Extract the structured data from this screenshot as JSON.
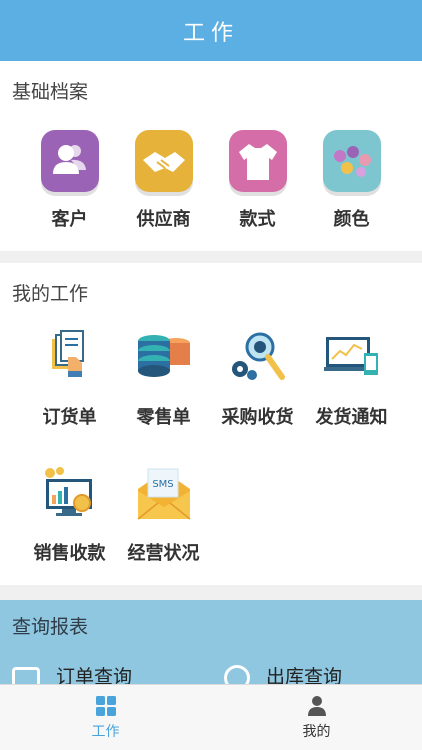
{
  "header": {
    "title": "工作"
  },
  "basic": {
    "title": "基础档案",
    "items": [
      {
        "label": "客户",
        "icon": "customers-icon"
      },
      {
        "label": "供应商",
        "icon": "handshake-icon"
      },
      {
        "label": "款式",
        "icon": "shirt-icon"
      },
      {
        "label": "颜色",
        "icon": "palette-icon"
      }
    ]
  },
  "work": {
    "title": "我的工作",
    "items": [
      {
        "label": "订货单",
        "icon": "order-doc-icon"
      },
      {
        "label": "零售单",
        "icon": "database-icon"
      },
      {
        "label": "采购收货",
        "icon": "gear-search-icon"
      },
      {
        "label": "发货通知",
        "icon": "monitor-chart-icon"
      },
      {
        "label": "销售收款",
        "icon": "monitor-coin-icon"
      },
      {
        "label": "经营状况",
        "icon": "sms-envelope-icon"
      }
    ],
    "sms_text": "SMS"
  },
  "report": {
    "title": "查询报表",
    "items": [
      {
        "label": "订单查询"
      },
      {
        "label": "出库查询"
      }
    ]
  },
  "tabbar": {
    "tabs": [
      {
        "label": "工作",
        "active": true
      },
      {
        "label": "我的",
        "active": false
      }
    ]
  },
  "colors": {
    "header": "#5bafe2",
    "tab_active": "#4aa4dc",
    "report_bg": "#8fc7e0"
  }
}
